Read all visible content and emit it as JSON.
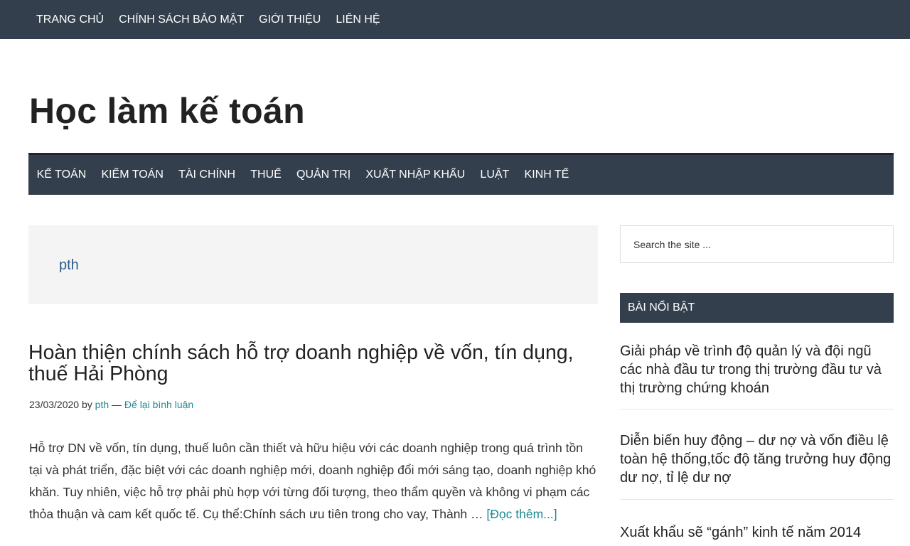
{
  "top_nav": {
    "items": [
      "TRANG CHỦ",
      "CHÍNH SÁCH BẢO MẬT",
      "GIỚI THIỆU",
      "LIÊN HỆ"
    ]
  },
  "site": {
    "title": "Học làm kế toán"
  },
  "main_nav": {
    "items": [
      "KẾ TOÁN",
      "KIỂM TOÁN",
      "TÀI CHÍNH",
      "THUẾ",
      "QUẢN TRỊ",
      "XUẤT NHẬP KHẨU",
      "LUẬT",
      "KINH TẾ"
    ]
  },
  "archive": {
    "author": "pth"
  },
  "post": {
    "title": "Hoàn thiện chính sách hỗ trợ doanh nghiệp về vốn, tín dụng, thuế Hải Phòng",
    "date": "23/03/2020",
    "by": "by",
    "author": "pth",
    "separator": "—",
    "comments": "Để lại bình luận",
    "excerpt": "Hỗ trợ DN về vốn, tín dụng, thuế luôn cần thiết và hữu hiệu với các doanh nghiệp trong quá trình tồn tại và phát triển, đặc biệt với các doanh nghiệp mới, doanh nghiệp đổi mới sáng tạo, doanh nghiệp khó khăn. Tuy nhiên, việc hỗ trợ phải phù hợp với từng đối tượng, theo thẩm quyền và không vi phạm các thỏa thuận và cam kết quốc tế. Cụ thể:Chính sách ưu tiên trong cho vay, Thành …",
    "read_more": "[Đọc thêm...]"
  },
  "sidebar": {
    "search_placeholder": "Search the site ...",
    "widget_title": "BÀI NỔI BẬT",
    "featured": [
      "Giải pháp về trình độ quản lý và đội ngũ các nhà đầu tư trong thị trường đầu tư và thị trường chứng khoán",
      "Diễn biến huy động – dư nợ và vốn điều lệ toàn hệ thống,tốc độ tăng trưởng huy động dư nợ, tỉ lệ dư nợ",
      "Xuất khẩu sẽ “gánh” kinh tế năm 2014"
    ]
  }
}
